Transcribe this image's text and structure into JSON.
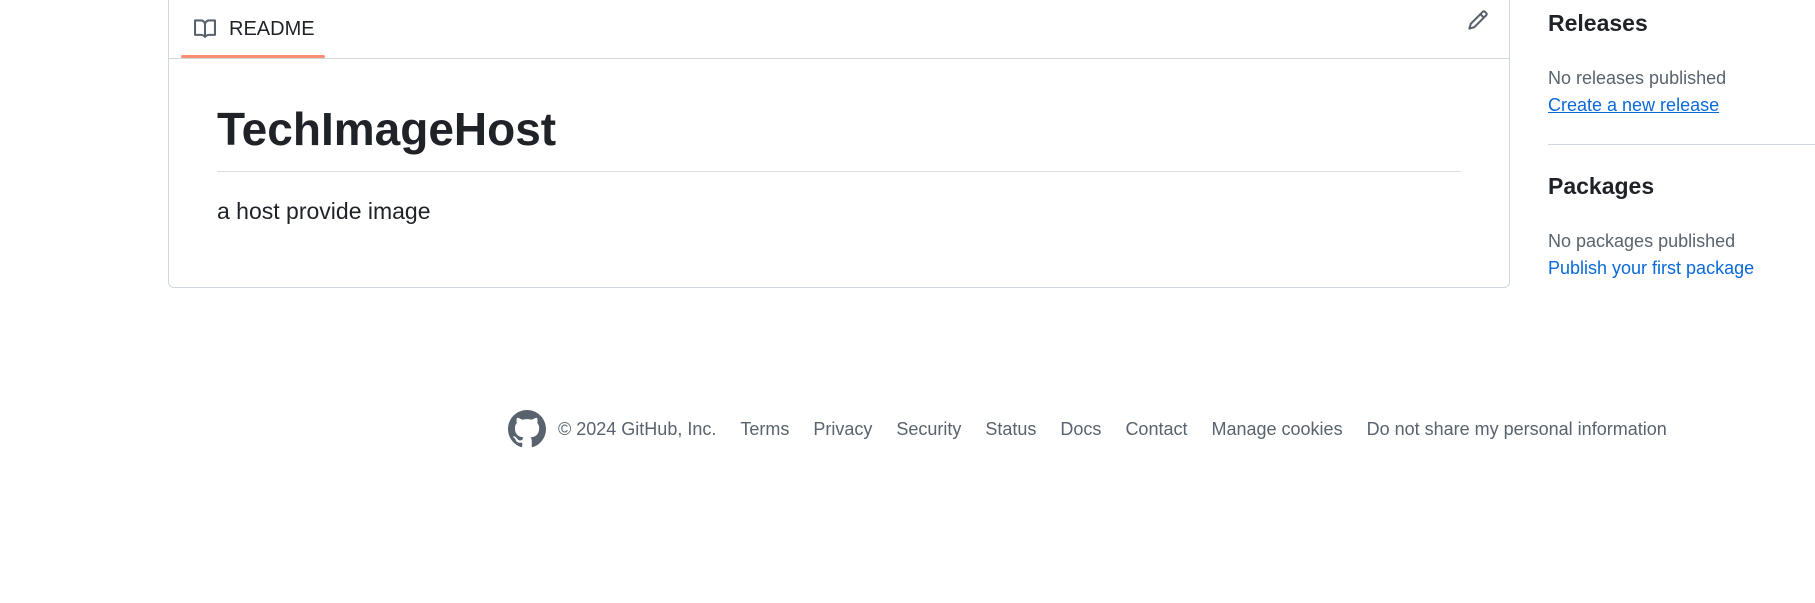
{
  "readme": {
    "tab_label": "README",
    "title": "TechImageHost",
    "description": "a host provide image"
  },
  "sidebar": {
    "releases": {
      "heading": "Releases",
      "empty_text": "No releases published",
      "link": "Create a new release"
    },
    "packages": {
      "heading": "Packages",
      "empty_text": "No packages published",
      "link": "Publish your first package"
    }
  },
  "footer": {
    "copyright": "© 2024 GitHub, Inc.",
    "links": [
      "Terms",
      "Privacy",
      "Security",
      "Status",
      "Docs",
      "Contact",
      "Manage cookies",
      "Do not share my personal information"
    ]
  },
  "icons": {
    "readme_tab": "book-icon",
    "edit": "pencil-icon",
    "footer_logo": "github-logo-icon"
  },
  "colors": {
    "tab_underline": "#fd8c73",
    "link": "#0969da",
    "muted": "#59636e",
    "border": "#d0d7de",
    "text": "#1f2328"
  }
}
